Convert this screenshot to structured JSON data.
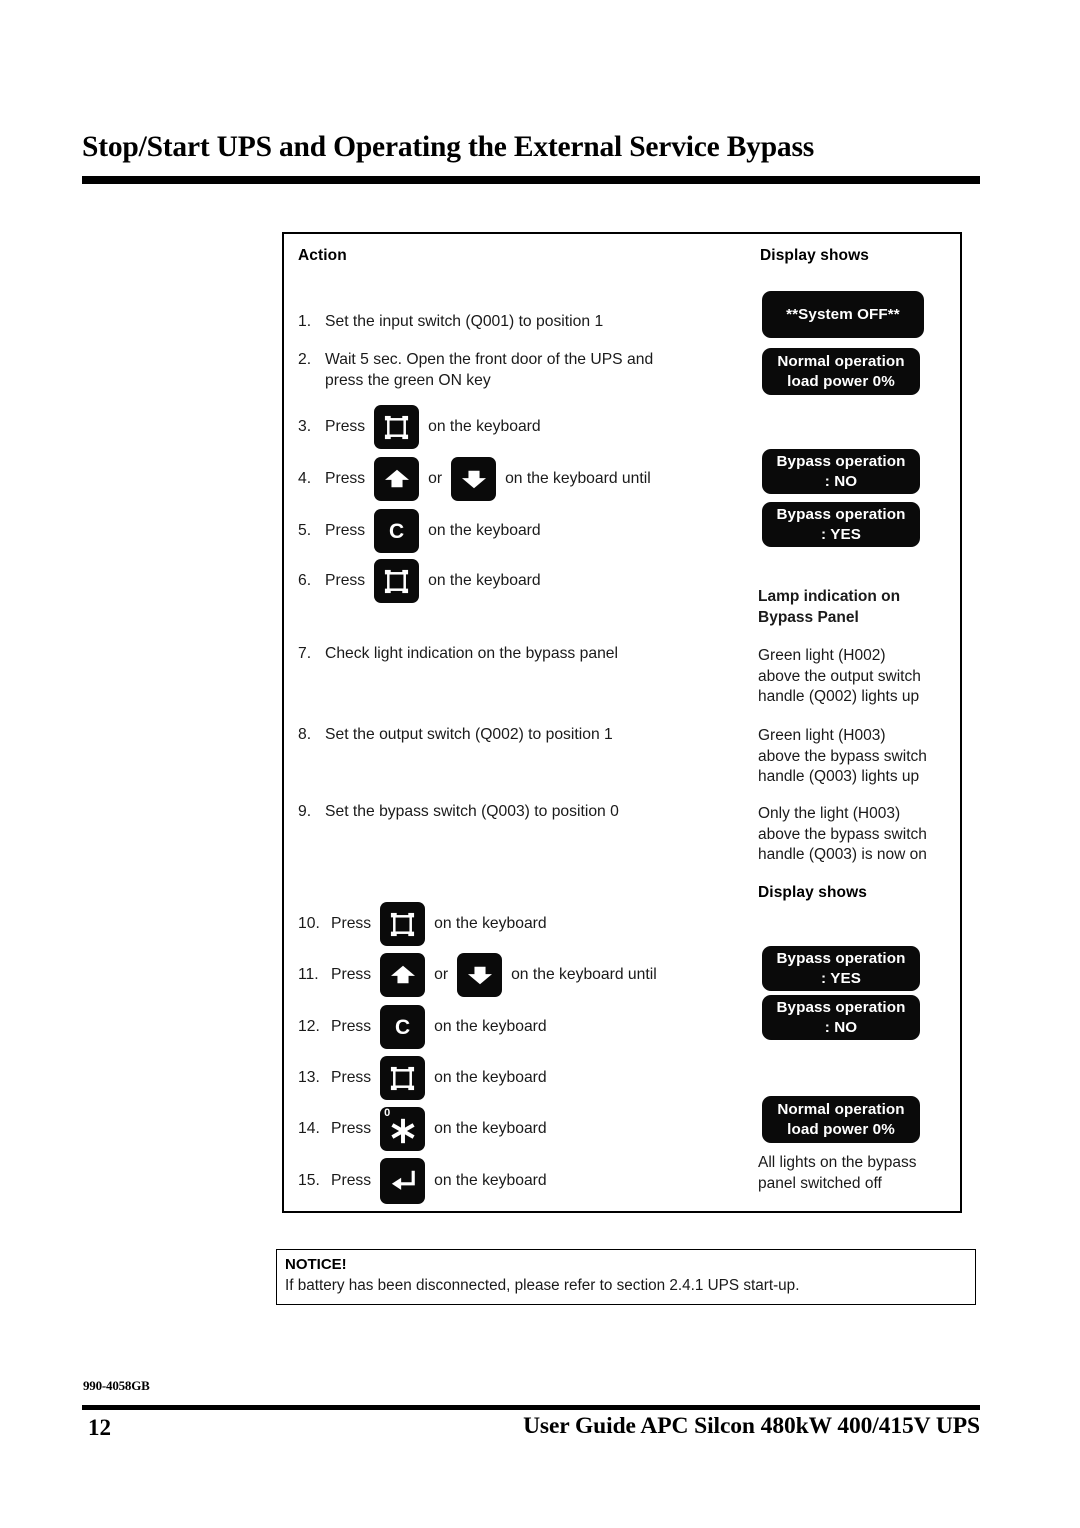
{
  "page": {
    "title": "Stop/Start UPS and Operating the External Service Bypass",
    "doc_code": "990-4058GB",
    "page_number": "12",
    "footer_title": "User Guide APC Silcon 480kW 400/415V UPS"
  },
  "table": {
    "headers": {
      "action": "Action",
      "display_shows_1": "Display shows",
      "lamp_indication": "Lamp indication on",
      "lamp_indication_2": "Bypass Panel",
      "display_shows_2": "Display shows"
    },
    "steps": [
      {
        "num": "1.",
        "text": "Set the input switch (Q001) to position 1"
      },
      {
        "num": "2.",
        "line1": "Wait 5 sec. Open the front door of the UPS and",
        "line2": "press the green ON key"
      },
      {
        "num": "3.",
        "pre": "Press",
        "key": "frame",
        "post": "on the keyboard"
      },
      {
        "num": "4.",
        "pre": "Press",
        "key": "arrow-up",
        "mid": "or",
        "key2": "arrow-down",
        "post": "on the keyboard until"
      },
      {
        "num": "5.",
        "pre": "Press",
        "key": "letter-c",
        "post": "on the keyboard"
      },
      {
        "num": "6.",
        "pre": "Press",
        "key": "frame",
        "post": "on the keyboard"
      },
      {
        "num": "7.",
        "text": "Check light indication on the bypass panel"
      },
      {
        "num": "8.",
        "text": "Set the output switch (Q002) to position 1"
      },
      {
        "num": "9.",
        "text": "Set the bypass switch (Q003) to position 0"
      },
      {
        "num": "10.",
        "pre": "Press",
        "key": "frame",
        "post": "on the keyboard"
      },
      {
        "num": "11.",
        "pre": "Press",
        "key": "arrow-up",
        "mid": "or",
        "key2": "arrow-down",
        "post": "on the keyboard until"
      },
      {
        "num": "12.",
        "pre": "Press",
        "key": "letter-c",
        "post": "on the keyboard"
      },
      {
        "num": "13.",
        "pre": "Press",
        "key": "frame",
        "post": "on the keyboard"
      },
      {
        "num": "14.",
        "pre": "Press",
        "key": "zero-asterisk",
        "post": "on the keyboard"
      },
      {
        "num": "15.",
        "pre": "Press",
        "key": "enter",
        "post": "on the keyboard"
      }
    ],
    "keys": {
      "frame": "frame-key",
      "arrow_up": "arrow-up-key",
      "arrow_down": "arrow-down-key",
      "letter_c": "C",
      "zero_asterisk_corner": "0",
      "zero_asterisk": "asterisk-key",
      "enter": "enter-key"
    },
    "displays": [
      {
        "id": "system-off",
        "line1": "**System OFF**",
        "line2": ""
      },
      {
        "id": "normal-operation-1",
        "line1": "Normal operation",
        "line2": "load power 0%"
      },
      {
        "id": "bypass-no-1",
        "line1": "Bypass operation",
        "line2": ":  NO"
      },
      {
        "id": "bypass-yes-1",
        "line1": "Bypass operation",
        "line2": ":  YES"
      },
      {
        "id": "bypass-yes-2",
        "line1": "Bypass operation",
        "line2": ":  YES"
      },
      {
        "id": "bypass-no-2",
        "line1": "Bypass operation",
        "line2": ":  NO"
      },
      {
        "id": "normal-operation-2",
        "line1": "Normal operation",
        "line2": "load power 0%"
      }
    ],
    "lamp_results": [
      {
        "id": "lamp-h002",
        "line1": "Green light (H002)",
        "line2": "above the output switch",
        "line3": "handle (Q002) lights up"
      },
      {
        "id": "lamp-h003",
        "line1": "Green light (H003)",
        "line2": "above the bypass switch",
        "line3": "handle (Q003) lights up"
      },
      {
        "id": "lamp-h003-only",
        "line1": "Only the light (H003)",
        "line2": "above the bypass switch",
        "line3": "handle (Q003) is now on"
      }
    ],
    "final_result": {
      "line1": "All lights on the bypass",
      "line2": "panel switched off"
    }
  },
  "notice": {
    "title": "NOTICE!",
    "body": "If battery has been disconnected, please refer to section 2.4.1 UPS start-up."
  },
  "colors": {
    "ink": "#000000",
    "lcd_background": "#0a0a0a",
    "lcd_text": "#ffffff",
    "paper": "#ffffff"
  }
}
